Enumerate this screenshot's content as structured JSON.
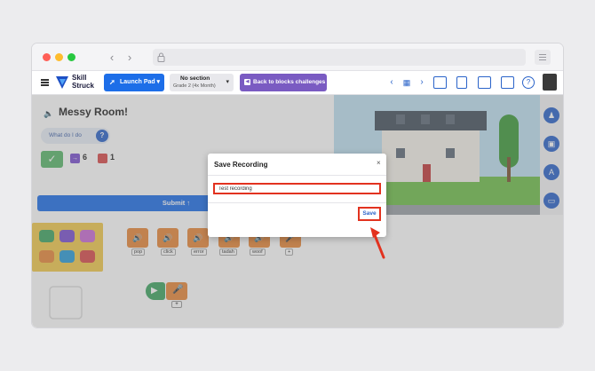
{
  "browser": {
    "icons": [
      "close-dot",
      "minimize-dot",
      "maximize-dot",
      "back-icon",
      "forward-icon",
      "lock-icon",
      "menu-icon"
    ]
  },
  "header": {
    "logo_line1": "Skill",
    "logo_line2": "Struck",
    "launch_pad": "Launch Pad",
    "section_title": "No section",
    "section_subtitle": "Grade 2 (4x Month)",
    "back_button": "Back to blocks challenges"
  },
  "challenge": {
    "title": "Messy Room!",
    "what_do_i_do": "What do I do",
    "help_mark": "?",
    "count_a": "6",
    "count_b": "1",
    "submit": "Submit ↑"
  },
  "sound_blocks": [
    {
      "label": "pop"
    },
    {
      "label": "click"
    },
    {
      "label": "error"
    },
    {
      "label": "tadah"
    },
    {
      "label": "woof"
    },
    {
      "label": "+"
    }
  ],
  "workspace": {
    "plus_tag": "+"
  },
  "modal": {
    "title": "Save Recording",
    "close": "×",
    "input_value": "Test recording",
    "save_label": "Save"
  },
  "colors": {
    "primary_blue": "#1d6ee8",
    "purple": "#7a5bc2",
    "highlight_red": "#e2321f",
    "palette_yellow": "#f2c94c",
    "sound_orange": "#e8883a"
  }
}
